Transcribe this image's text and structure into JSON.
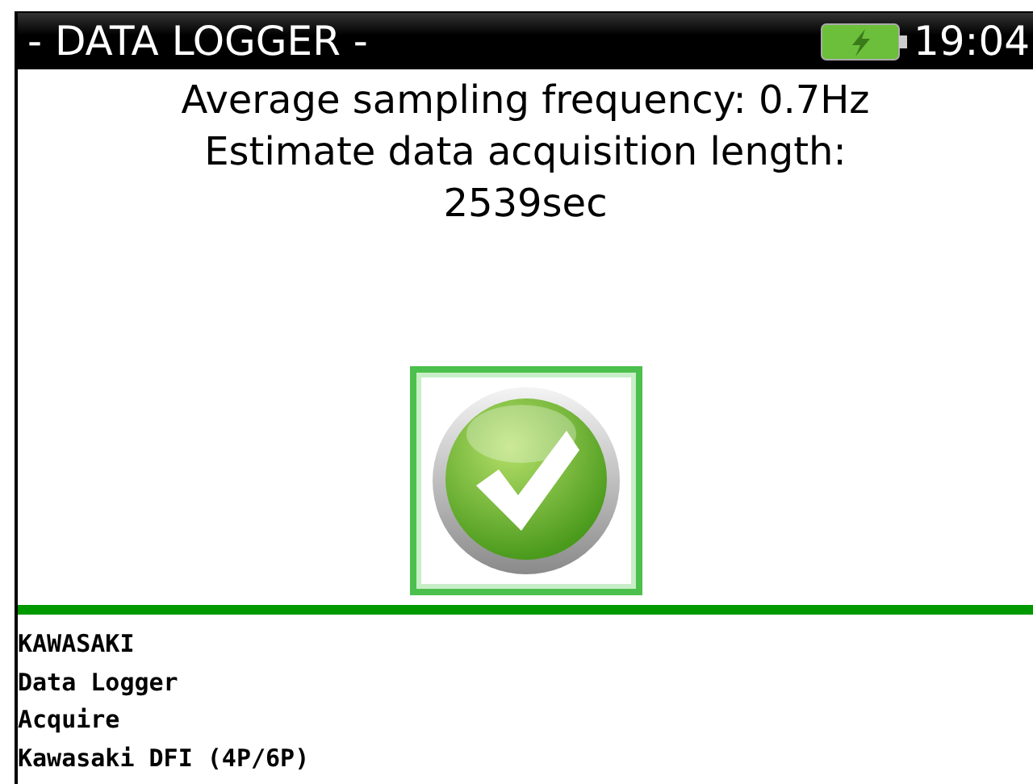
{
  "title_bar": {
    "title": "- DATA LOGGER -",
    "battery": {
      "charging": true
    },
    "time": "19:04"
  },
  "message": [
    "Average sampling frequency: 0.7Hz",
    "Estimate data acquisition length:",
    "2539sec"
  ],
  "confirm_button": {
    "selected": true
  },
  "breadcrumb": [
    "KAWASAKI",
    "Data Logger",
    "Acquire",
    "Kawasaki DFI (4P/6P)"
  ]
}
